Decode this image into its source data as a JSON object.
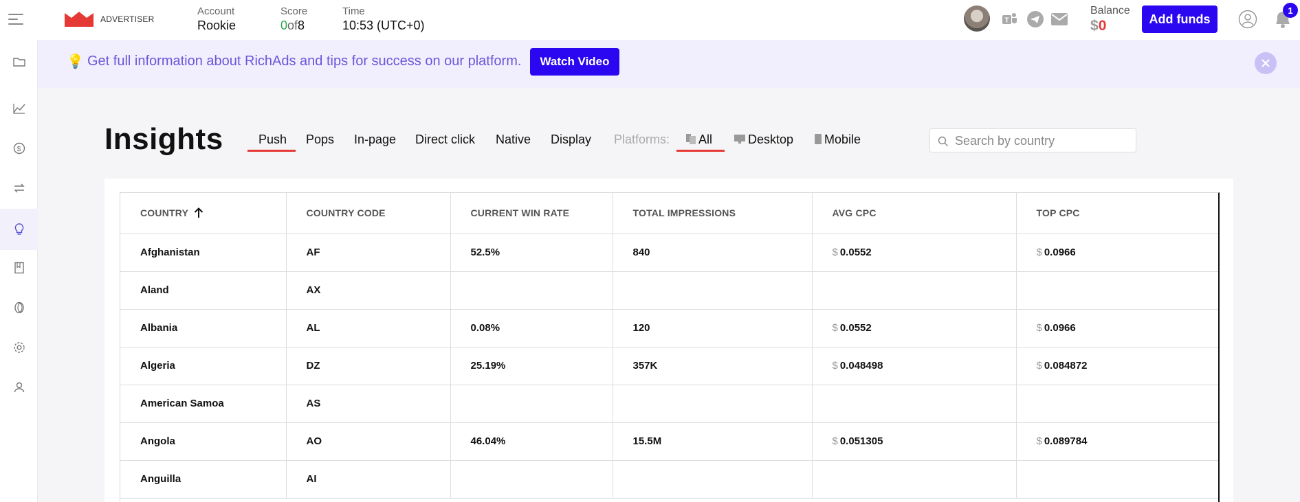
{
  "header": {
    "logo_text": "ADVERTISER",
    "account": {
      "label": "Account",
      "value": "Rookie"
    },
    "score": {
      "label": "Score",
      "current": "0",
      "of": "of",
      "total": "8"
    },
    "time": {
      "label": "Time",
      "value": "10:53 (UTC+0)"
    },
    "balance": {
      "label": "Balance",
      "currency": "$",
      "amount": "0"
    },
    "add_funds_label": "Add funds",
    "notification_count": "1",
    "icons": [
      "teams-icon",
      "telegram-icon",
      "mail-icon",
      "user-icon",
      "bell-icon"
    ]
  },
  "sidebar": {
    "items": [
      {
        "name": "campaigns",
        "icon": "folder-icon"
      },
      {
        "name": "statistics",
        "icon": "chart-icon"
      },
      {
        "name": "finance",
        "icon": "coin-icon"
      },
      {
        "name": "transactions",
        "icon": "transfer-icon"
      },
      {
        "name": "insights",
        "icon": "lightbulb-icon",
        "active": true
      },
      {
        "name": "knowledge-base",
        "icon": "book-icon"
      },
      {
        "name": "api",
        "icon": "ring-icon"
      },
      {
        "name": "settings",
        "icon": "gear-icon"
      },
      {
        "name": "profile",
        "icon": "person-icon"
      }
    ]
  },
  "banner": {
    "icon": "💡",
    "text": "Get full information about RichAds and tips for success on our platform.",
    "button_label": "Watch Video"
  },
  "insights": {
    "title": "Insights",
    "tabs": [
      "Push",
      "Pops",
      "In-page",
      "Direct click",
      "Native",
      "Display"
    ],
    "active_tab": "Push",
    "platforms_label": "Platforms:",
    "platforms": [
      "All",
      "Desktop",
      "Mobile"
    ],
    "active_platform": "All",
    "search_placeholder": "Search by country"
  },
  "table": {
    "columns": [
      "COUNTRY",
      "COUNTRY CODE",
      "CURRENT WIN RATE",
      "TOTAL IMPRESSIONS",
      "AVG CPC",
      "TOP CPC"
    ],
    "sort_column": "COUNTRY",
    "currency_sign": "$",
    "rows": [
      {
        "country": "Afghanistan",
        "code": "AF",
        "win_rate": "52.5%",
        "impressions": "840",
        "avg_cpc": "0.0552",
        "top_cpc": "0.0966"
      },
      {
        "country": "Aland",
        "code": "AX",
        "win_rate": "",
        "impressions": "",
        "avg_cpc": "",
        "top_cpc": ""
      },
      {
        "country": "Albania",
        "code": "AL",
        "win_rate": "0.08%",
        "impressions": "120",
        "avg_cpc": "0.0552",
        "top_cpc": "0.0966"
      },
      {
        "country": "Algeria",
        "code": "DZ",
        "win_rate": "25.19%",
        "impressions": "357K",
        "avg_cpc": "0.048498",
        "top_cpc": "0.084872"
      },
      {
        "country": "American Samoa",
        "code": "AS",
        "win_rate": "",
        "impressions": "",
        "avg_cpc": "",
        "top_cpc": ""
      },
      {
        "country": "Angola",
        "code": "AO",
        "win_rate": "46.04%",
        "impressions": "15.5M",
        "avg_cpc": "0.051305",
        "top_cpc": "0.089784"
      },
      {
        "country": "Anguilla",
        "code": "AI",
        "win_rate": "",
        "impressions": "",
        "avg_cpc": "",
        "top_cpc": ""
      }
    ]
  },
  "colors": {
    "primary": "#2a07f0",
    "accent_red": "#e53935",
    "banner_bg": "#f1eefe",
    "banner_text": "#6a57d9",
    "score_green": "#2aa84a"
  }
}
